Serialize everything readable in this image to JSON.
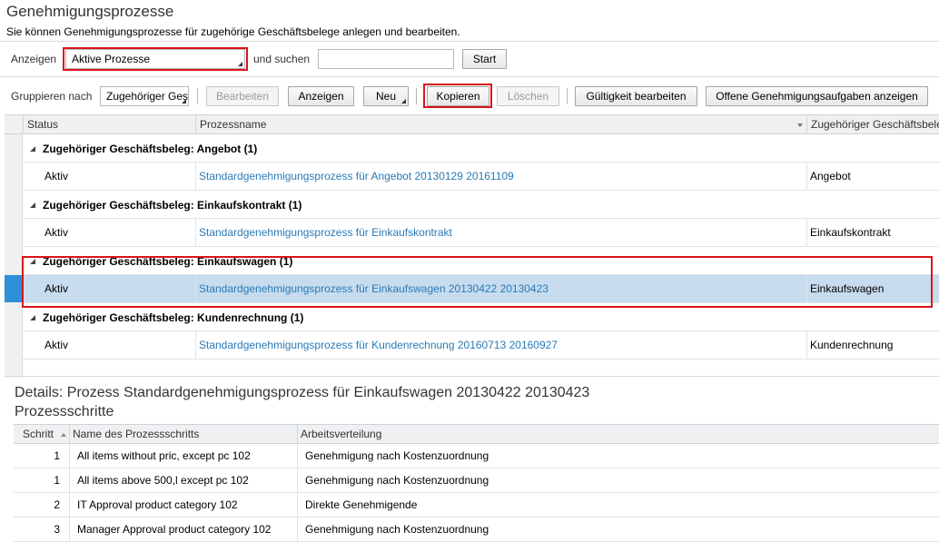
{
  "page": {
    "title": "Genehmigungsprozesse",
    "subtitle": "Sie können Genehmigungsprozesse für zugehörige Geschäftsbelege anlegen und bearbeiten."
  },
  "search": {
    "show_label": "Anzeigen",
    "show_value": "Aktive Prozesse",
    "and_search_label": "und suchen",
    "search_value": "",
    "start_button": "Start"
  },
  "toolbar": {
    "group_by_label": "Gruppieren nach",
    "group_by_value": "Zugehöriger Geschäftsbeleg",
    "edit": "Bearbeiten",
    "show": "Anzeigen",
    "new": "Neu",
    "copy": "Kopieren",
    "delete": "Löschen",
    "edit_validity": "Gültigkeit bearbeiten",
    "show_open_tasks": "Offene Genehmigungsaufgaben anzeigen"
  },
  "table": {
    "columns": [
      "Status",
      "Prozessname",
      "Zugehöriger Geschäftsbeleg"
    ],
    "groups": [
      {
        "label": "Zugehöriger Geschäftsbeleg: Angebot (1)",
        "row": {
          "status": "Aktiv",
          "name": "Standardgenehmigungsprozess für Angebot 20130129 20161109",
          "doc": "Angebot"
        }
      },
      {
        "label": "Zugehöriger Geschäftsbeleg: Einkaufskontrakt (1)",
        "row": {
          "status": "Aktiv",
          "name": "Standardgenehmigungsprozess für Einkaufskontrakt",
          "doc": "Einkaufskontrakt"
        }
      },
      {
        "label": "Zugehöriger Geschäftsbeleg: Einkaufswagen (1)",
        "row": {
          "status": "Aktiv",
          "name": "Standardgenehmigungsprozess für Einkaufswagen 20130422 20130423",
          "doc": "Einkaufswagen"
        }
      },
      {
        "label": "Zugehöriger Geschäftsbeleg: Kundenrechnung (1)",
        "row": {
          "status": "Aktiv",
          "name": "Standardgenehmigungsprozess für Kundenrechnung 20160713 20160927",
          "doc": "Kundenrechnung"
        }
      }
    ]
  },
  "details": {
    "title": "Details: Prozess Standardgenehmigungsprozess für Einkaufswagen 20130422 20130423",
    "steps_title": "Prozessschritte",
    "columns": [
      "Schritt",
      "Name des Prozessschritts",
      "Arbeitsverteilung"
    ],
    "rows": [
      {
        "step": "1",
        "name": "All items without pric, except pc 102",
        "dist": "Genehmigung nach Kostenzuordnung"
      },
      {
        "step": "1",
        "name": "All items above 500,l except pc 102",
        "dist": "Genehmigung nach Kostenzuordnung"
      },
      {
        "step": "2",
        "name": "IT Approval product category 102",
        "dist": "Direkte Genehmigende"
      },
      {
        "step": "3",
        "name": "Manager Approval product category 102",
        "dist": "Genehmigung nach Kostenzuordnung"
      }
    ]
  },
  "colors": {
    "link": "#2a7ab6",
    "selected_row": "#c7dcee",
    "selection_marker": "#2f8fd8",
    "highlight": "#d9151b"
  }
}
